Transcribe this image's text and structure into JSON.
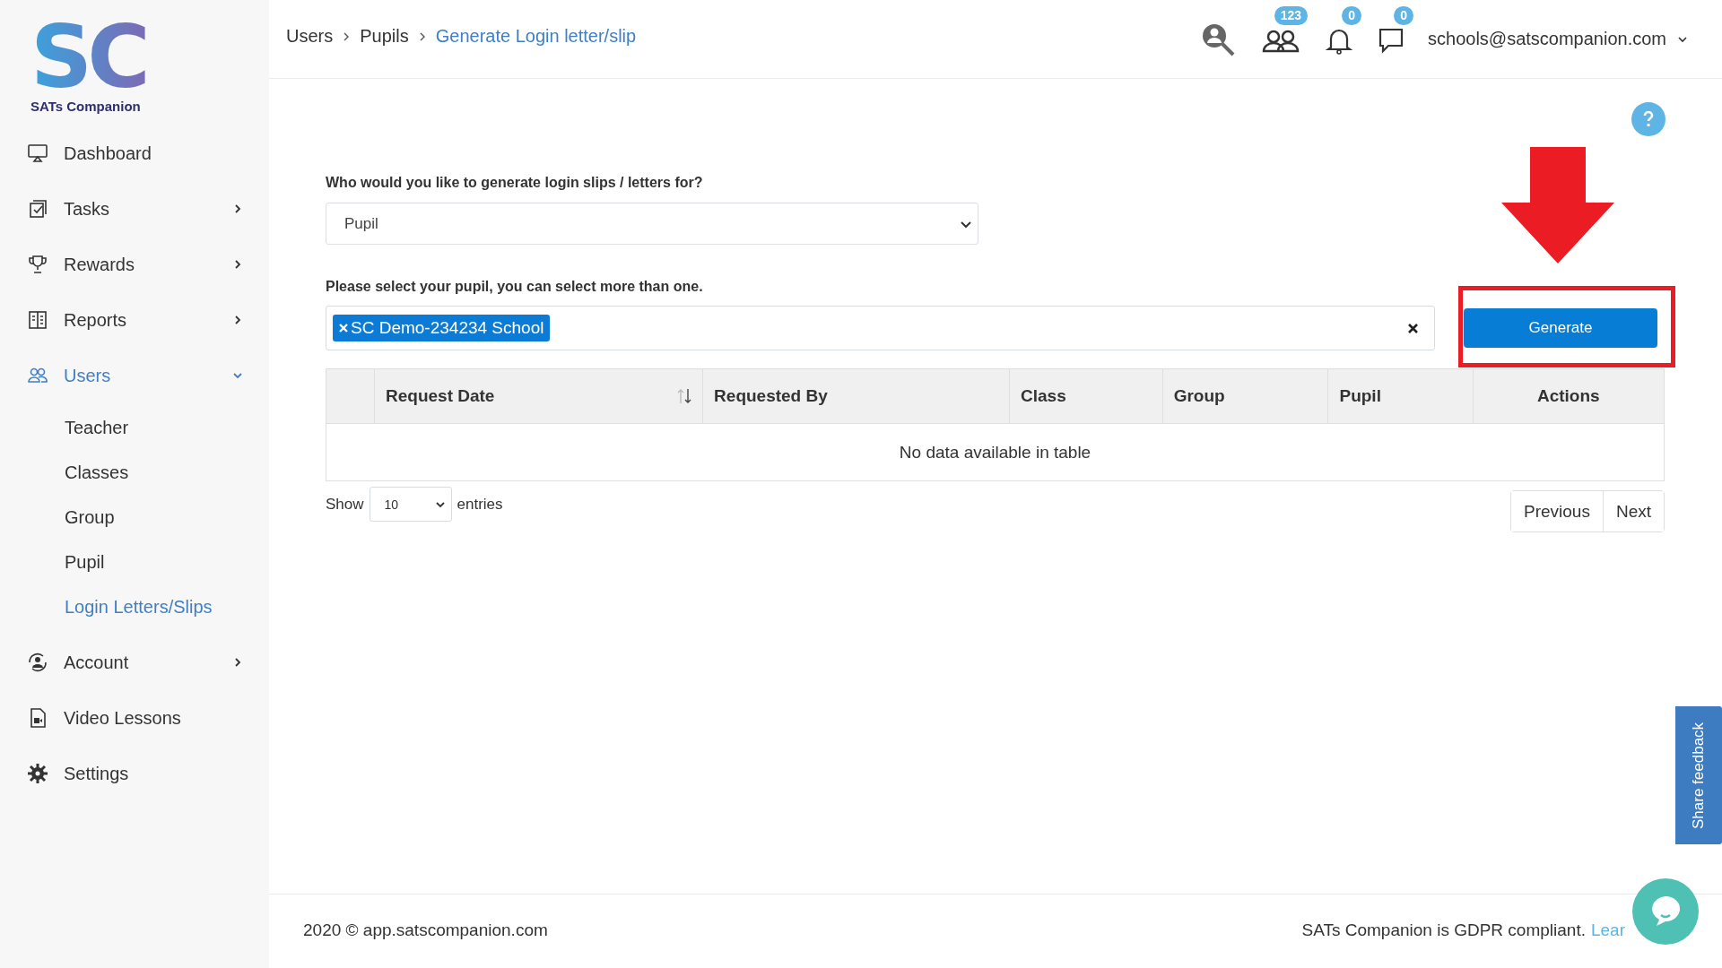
{
  "sidebar": {
    "logo": {
      "mark": "SC",
      "name": "SATs Companion"
    },
    "items": [
      {
        "label": "Dashboard",
        "selected": false
      },
      {
        "label": "Tasks",
        "selected": false,
        "expanded": false
      },
      {
        "label": "Rewards",
        "selected": false,
        "expanded": false
      },
      {
        "label": "Reports",
        "selected": false,
        "expanded": false
      },
      {
        "label": "Users",
        "selected": true,
        "expanded": true,
        "children": [
          {
            "label": "Teacher",
            "selected": false
          },
          {
            "label": "Classes",
            "selected": false
          },
          {
            "label": "Group",
            "selected": false
          },
          {
            "label": "Pupil",
            "selected": false
          },
          {
            "label": "Login Letters/Slips",
            "selected": true
          }
        ]
      },
      {
        "label": "Account",
        "selected": false,
        "expanded": false
      },
      {
        "label": "Video Lessons",
        "selected": false
      },
      {
        "label": "Settings",
        "selected": false
      }
    ]
  },
  "header": {
    "breadcrumb": [
      {
        "label": "Users",
        "current": false
      },
      {
        "label": "Pupils",
        "current": false
      },
      {
        "label": "Generate Login letter/slip",
        "current": true
      }
    ],
    "badges": [
      "123",
      "0",
      "0"
    ],
    "user": "schools@satscompanion.com"
  },
  "form": {
    "audience_label": "Who would you like to generate login slips / letters for?",
    "audience_value": "Pupil",
    "pupil_label": "Please select your pupil, you can select more than one.",
    "pupil_tags": [
      "SC Demo-234234 School"
    ],
    "generate_button": "Generate"
  },
  "table": {
    "columns": [
      {
        "label": "Request Date",
        "sortable": true
      },
      {
        "label": "Requested By",
        "sortable": false
      },
      {
        "label": "Class",
        "sortable": false
      },
      {
        "label": "Group",
        "sortable": false
      },
      {
        "label": "Pupil",
        "sortable": false
      },
      {
        "label": "Actions",
        "sortable": false
      }
    ],
    "empty_message": "No data available in table",
    "length": {
      "before": "Show",
      "value": "10",
      "after": "entries"
    },
    "pagination": [
      "Previous",
      "Next"
    ]
  },
  "footer": {
    "copyright": "2020 © app.satscompanion.com",
    "gdpr": "SATs Companion is GDPR compliant.",
    "link": "Lear"
  },
  "feedback_tab": "Share feedback"
}
